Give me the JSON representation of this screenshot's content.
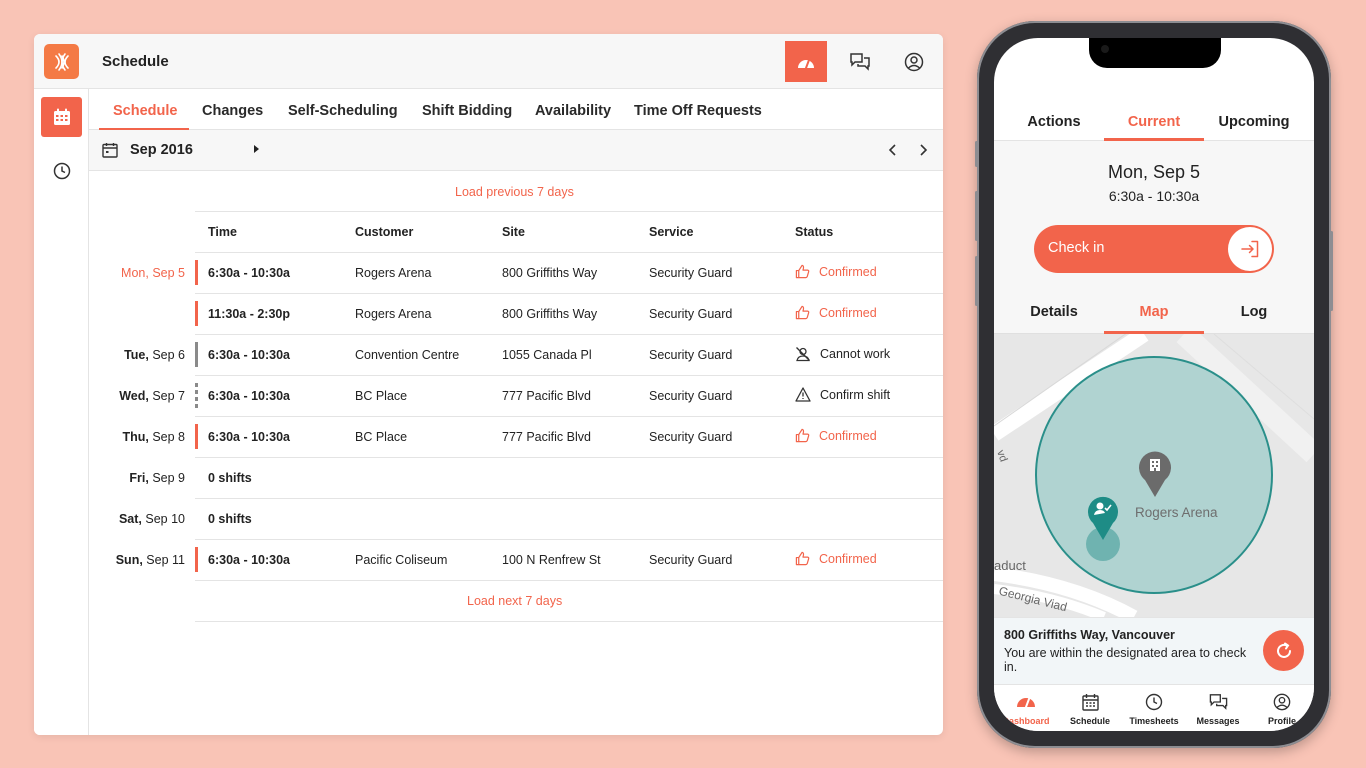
{
  "app": {
    "title": "Schedule"
  },
  "tabs": [
    "Schedule",
    "Changes",
    "Self-Scheduling",
    "Shift Bidding",
    "Availability",
    "Time Off Requests"
  ],
  "datebar": {
    "label": "Sep 2016"
  },
  "load_previous": "Load previous 7 days",
  "load_next": "Load next 7 days",
  "columns": {
    "time": "Time",
    "customer": "Customer",
    "site": "Site",
    "service": "Service",
    "status": "Status"
  },
  "rows": [
    {
      "day": "Mon,",
      "date": "Sep 5",
      "time": "6:30a - 10:30a",
      "customer": "Rogers Arena",
      "site": "800 Griffiths Way",
      "service": "Security Guard",
      "status": "Confirmed"
    },
    {
      "day": "",
      "date": "",
      "time": "11:30a - 2:30p",
      "customer": "Rogers Arena",
      "site": "800 Griffiths Way",
      "service": "Security Guard",
      "status": "Confirmed"
    },
    {
      "day": "Tue,",
      "date": "Sep 6",
      "time": "6:30a - 10:30a",
      "customer": "Convention Centre",
      "site": "1055 Canada Pl",
      "service": "Security Guard",
      "status": "Cannot work"
    },
    {
      "day": "Wed,",
      "date": "Sep 7",
      "time": "6:30a - 10:30a",
      "customer": "BC Place",
      "site": "777 Pacific Blvd",
      "service": "Security Guard",
      "status": "Confirm shift"
    },
    {
      "day": "Thu,",
      "date": "Sep 8",
      "time": "6:30a - 10:30a",
      "customer": "BC Place",
      "site": "777 Pacific Blvd",
      "service": "Security Guard",
      "status": "Confirmed"
    },
    {
      "day": "Fri,",
      "date": "Sep 9",
      "time": "0 shifts"
    },
    {
      "day": "Sat,",
      "date": "Sep 10",
      "time": "0 shifts"
    },
    {
      "day": "Sun,",
      "date": "Sep 11",
      "time": "6:30a - 10:30a",
      "customer": "Pacific Coliseum",
      "site": "100 N Renfrew St",
      "service": "Security Guard",
      "status": "Confirmed"
    }
  ],
  "phone": {
    "tabs": [
      "Actions",
      "Current",
      "Upcoming"
    ],
    "shift_date": "Mon, Sep 5",
    "shift_hours": "6:30a - 10:30a",
    "checkin_label": "Check in",
    "subtabs": [
      "Details",
      "Map",
      "Log"
    ],
    "map": {
      "venue_label": "Rogers Arena",
      "street_1": "Georgia Viad",
      "street_2": "aduct",
      "street_3": "vd"
    },
    "address_title": "800 Griffiths Way, Vancouver",
    "address_msg": "You are within the designated area to check in.",
    "nav": [
      "Dashboard",
      "Schedule",
      "Timesheets",
      "Messages",
      "Profile"
    ]
  },
  "colors": {
    "accent": "#f2644b",
    "background": "#f9c4b6",
    "geofence": "#2a8f8a"
  }
}
